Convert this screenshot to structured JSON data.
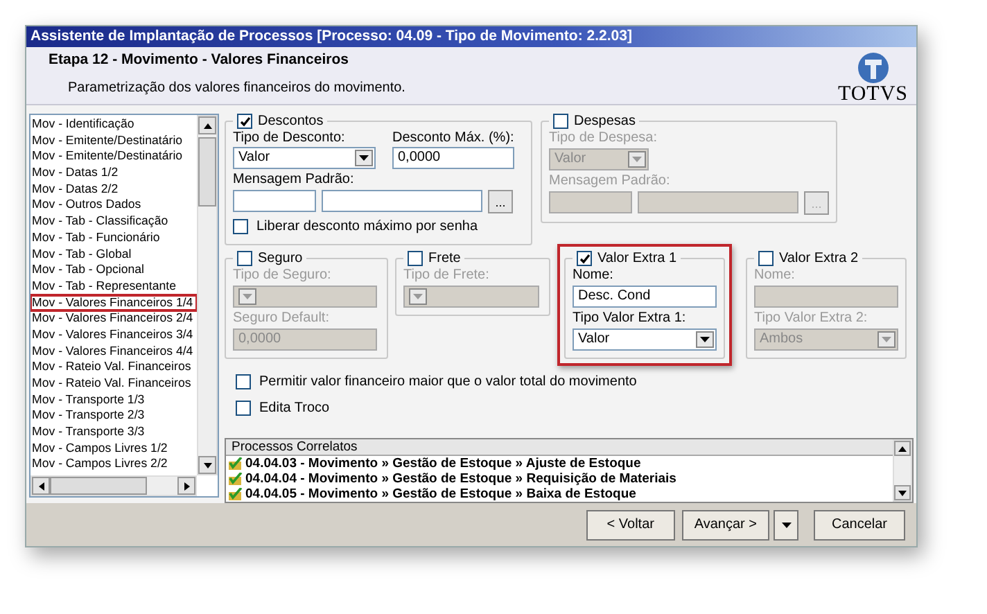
{
  "window": {
    "title": "Assistente de Implantação de Processos [Processo: 04.09 - Tipo de Movimento: 2.2.03]"
  },
  "header": {
    "step": "Etapa 12 - Movimento - Valores Financeiros",
    "description": "Parametrização dos valores financeiros do movimento.",
    "logo": "TOTVS"
  },
  "sidebar": {
    "items": [
      {
        "label": "Mov - Identificação",
        "selected": false
      },
      {
        "label": "Mov - Emitente/Destinatário",
        "selected": false
      },
      {
        "label": "Mov - Emitente/Destinatário",
        "selected": false
      },
      {
        "label": "Mov - Datas 1/2",
        "selected": false
      },
      {
        "label": "Mov - Datas 2/2",
        "selected": false
      },
      {
        "label": "Mov - Outros Dados",
        "selected": false
      },
      {
        "label": "Mov - Tab - Classificação",
        "selected": false
      },
      {
        "label": "Mov - Tab - Funcionário",
        "selected": false
      },
      {
        "label": "Mov - Tab - Global",
        "selected": false
      },
      {
        "label": "Mov - Tab - Opcional",
        "selected": false
      },
      {
        "label": "Mov - Tab - Representante",
        "selected": false
      },
      {
        "label": "Mov - Valores Financeiros 1/4",
        "selected": true
      },
      {
        "label": "Mov - Valores Financeiros 2/4",
        "selected": false
      },
      {
        "label": "Mov - Valores Financeiros 3/4",
        "selected": false
      },
      {
        "label": "Mov - Valores Financeiros 4/4",
        "selected": false
      },
      {
        "label": "Mov - Rateio Val. Financeiros",
        "selected": false
      },
      {
        "label": "Mov - Rateio Val. Financeiros",
        "selected": false
      },
      {
        "label": "Mov - Transporte 1/3",
        "selected": false
      },
      {
        "label": "Mov - Transporte 2/3",
        "selected": false
      },
      {
        "label": "Mov - Transporte 3/3",
        "selected": false
      },
      {
        "label": "Mov - Campos Livres 1/2",
        "selected": false
      },
      {
        "label": "Mov - Campos Livres 2/2",
        "selected": false
      }
    ]
  },
  "descontos": {
    "label": "Descontos",
    "checked": true,
    "tipo_label": "Tipo de Desconto:",
    "tipo_value": "Valor",
    "max_label": "Desconto Máx. (%):",
    "max_value": "0,0000",
    "mensagem_label": "Mensagem Padrão:",
    "browse_button": "...",
    "liberar": {
      "label": "Liberar desconto máximo por senha",
      "checked": false
    }
  },
  "despesas": {
    "label": "Despesas",
    "checked": false,
    "tipo_label": "Tipo de Despesa:",
    "tipo_value": "Valor",
    "mensagem_label": "Mensagem Padrão:",
    "browse_button": "..."
  },
  "seguro": {
    "label": "Seguro",
    "checked": false,
    "tipo_label": "Tipo de Seguro:",
    "default_label": "Seguro Default:",
    "default_value": "0,0000"
  },
  "frete": {
    "label": "Frete",
    "checked": false,
    "tipo_label": "Tipo de Frete:"
  },
  "valor_extra_1": {
    "label": "Valor Extra 1",
    "checked": true,
    "highlighted": true,
    "nome_label": "Nome:",
    "nome_value": "Desc. Cond",
    "tipo_label": "Tipo Valor Extra 1:",
    "tipo_value": "Valor"
  },
  "valor_extra_2": {
    "label": "Valor Extra 2",
    "checked": false,
    "highlighted": false,
    "nome_label": "Nome:",
    "tipo_label": "Tipo Valor Extra 2:",
    "tipo_value": "Ambos"
  },
  "options": [
    {
      "label": "Permitir valor financeiro maior que o valor total do movimento",
      "checked": false
    },
    {
      "label": "Edita Troco",
      "checked": false
    }
  ],
  "related": {
    "title": "Processos Correlatos",
    "items": [
      "04.04.03 - Movimento » Gestão de Estoque » Ajuste de Estoque",
      "04.04.04 - Movimento » Gestão de Estoque » Requisição de Materiais",
      "04.04.05 - Movimento » Gestão de Estoque » Baixa de Estoque"
    ]
  },
  "buttons": [
    {
      "label": "< Voltar",
      "kind": "plain"
    },
    {
      "label": "Avançar >",
      "kind": "split"
    },
    {
      "label": "Cancelar",
      "kind": "plain"
    }
  ]
}
